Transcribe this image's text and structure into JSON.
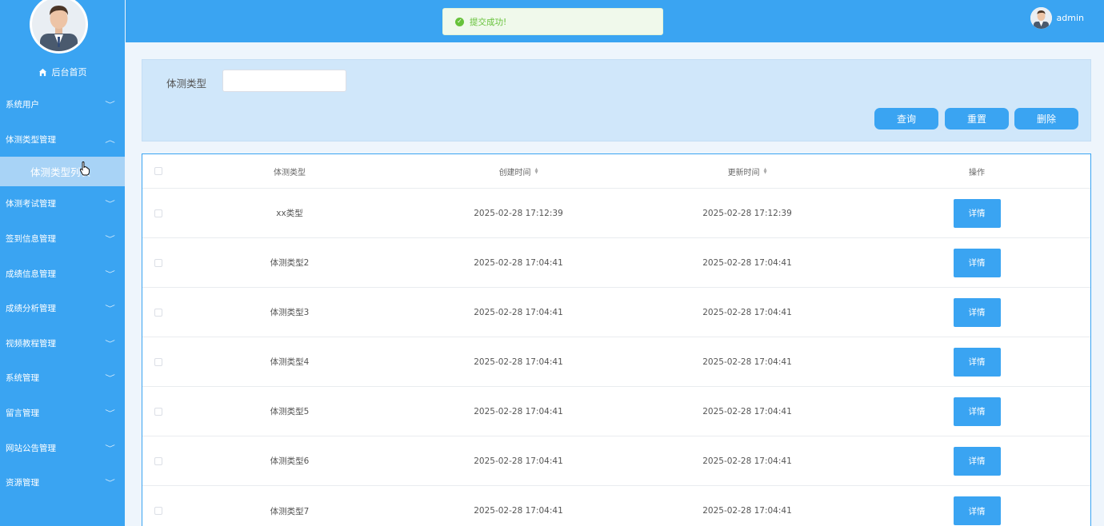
{
  "sidebar": {
    "home": "后台首页",
    "items": [
      {
        "label": "系统用户",
        "chevron": "﹀"
      },
      {
        "label": "体测类型管理",
        "chevron": "︿"
      },
      {
        "label": "体测考试管理",
        "chevron": "﹀"
      },
      {
        "label": "签到信息管理",
        "chevron": "﹀"
      },
      {
        "label": "成绩信息管理",
        "chevron": "﹀"
      },
      {
        "label": "成绩分析管理",
        "chevron": "﹀"
      },
      {
        "label": "视频教程管理",
        "chevron": "﹀"
      },
      {
        "label": "系统管理",
        "chevron": "﹀"
      },
      {
        "label": "留言管理",
        "chevron": "﹀"
      },
      {
        "label": "网站公告管理",
        "chevron": "﹀"
      },
      {
        "label": "资源管理",
        "chevron": "﹀"
      }
    ],
    "active_sub": "体测类型列表"
  },
  "topbar": {
    "username": "admin"
  },
  "toast": {
    "message": "提交成功!",
    "color": "#67c23a"
  },
  "search": {
    "label": "体测类型",
    "value": "",
    "buttons": {
      "query": "查询",
      "reset": "重置",
      "delete": "删除"
    }
  },
  "table": {
    "headers": {
      "type": "体测类型",
      "created": "创建时间",
      "updated": "更新时间",
      "ops": "操作"
    },
    "detail_label": "详情",
    "rows": [
      {
        "type": "xx类型",
        "created": "2025-02-28 17:12:39",
        "updated": "2025-02-28 17:12:39"
      },
      {
        "type": "体测类型2",
        "created": "2025-02-28 17:04:41",
        "updated": "2025-02-28 17:04:41"
      },
      {
        "type": "体测类型3",
        "created": "2025-02-28 17:04:41",
        "updated": "2025-02-28 17:04:41"
      },
      {
        "type": "体测类型4",
        "created": "2025-02-28 17:04:41",
        "updated": "2025-02-28 17:04:41"
      },
      {
        "type": "体测类型5",
        "created": "2025-02-28 17:04:41",
        "updated": "2025-02-28 17:04:41"
      },
      {
        "type": "体测类型6",
        "created": "2025-02-28 17:04:41",
        "updated": "2025-02-28 17:04:41"
      },
      {
        "type": "体测类型7",
        "created": "2025-02-28 17:04:41",
        "updated": "2025-02-28 17:04:41"
      }
    ]
  },
  "colors": {
    "primary": "#3aa4f2",
    "active_sub_bg": "#a8d3f6",
    "panel_bg": "#d0e7fa"
  }
}
